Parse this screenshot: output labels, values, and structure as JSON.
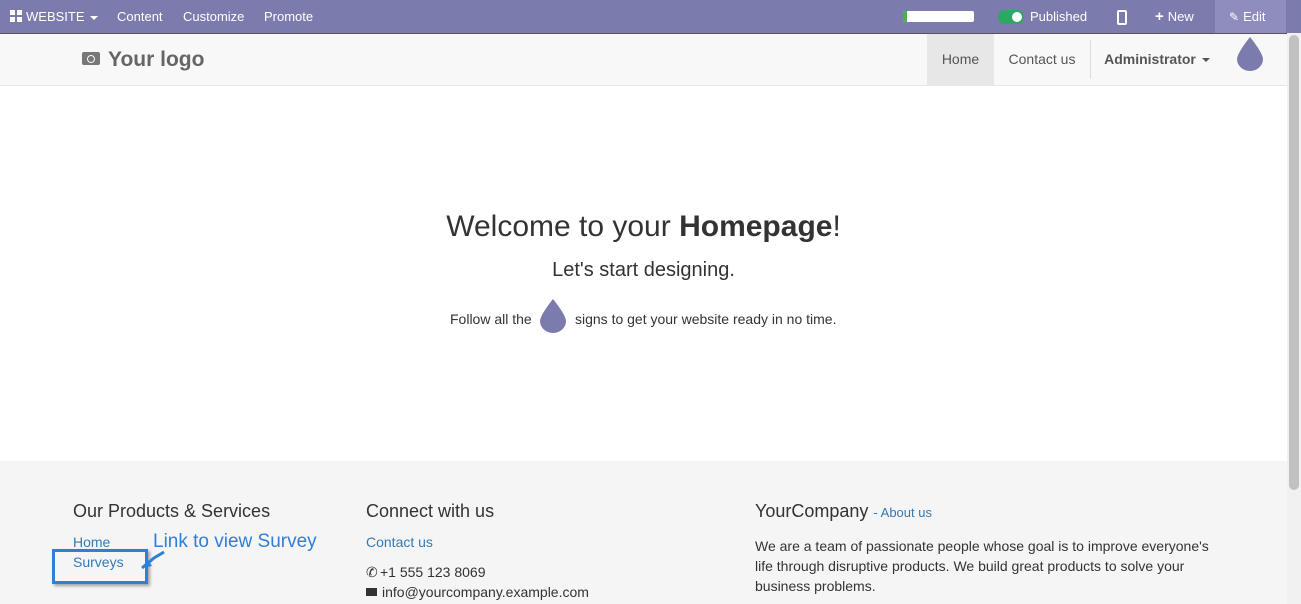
{
  "topbar": {
    "website_label": "WEBSITE",
    "content_label": "Content",
    "customize_label": "Customize",
    "promote_label": "Promote",
    "progress_fraction": 0.05,
    "published_label": "Published",
    "new_label": "New",
    "edit_label": "Edit"
  },
  "header": {
    "logo_text": "Your logo",
    "nav": {
      "home": "Home",
      "contact": "Contact us",
      "user": "Administrator"
    }
  },
  "hero": {
    "title_prefix": "Welcome to your ",
    "title_bold": "Homepage",
    "title_suffix": "!",
    "subtitle": "Let's start designing.",
    "follow_before": "Follow all the",
    "follow_after": "signs to get your website ready in no time."
  },
  "footer": {
    "products_heading": "Our Products & Services",
    "products_links": [
      "Home",
      "Surveys"
    ],
    "connect_heading": "Connect with us",
    "contact_link": "Contact us",
    "phone": "+1 555 123 8069",
    "email": "info@yourcompany.example.com",
    "company_name": "YourCompany",
    "about_link": "- About us",
    "about_text": "We are a team of passionate people whose goal is to improve everyone's life through disruptive products. We build great products to solve your business problems."
  },
  "annotation": {
    "text": "Link to view Survey"
  },
  "colors": {
    "topbar_bg": "#7c7bad",
    "link": "#337ab7",
    "annotation": "#2f7fd8",
    "published_toggle": "#2ba862"
  }
}
